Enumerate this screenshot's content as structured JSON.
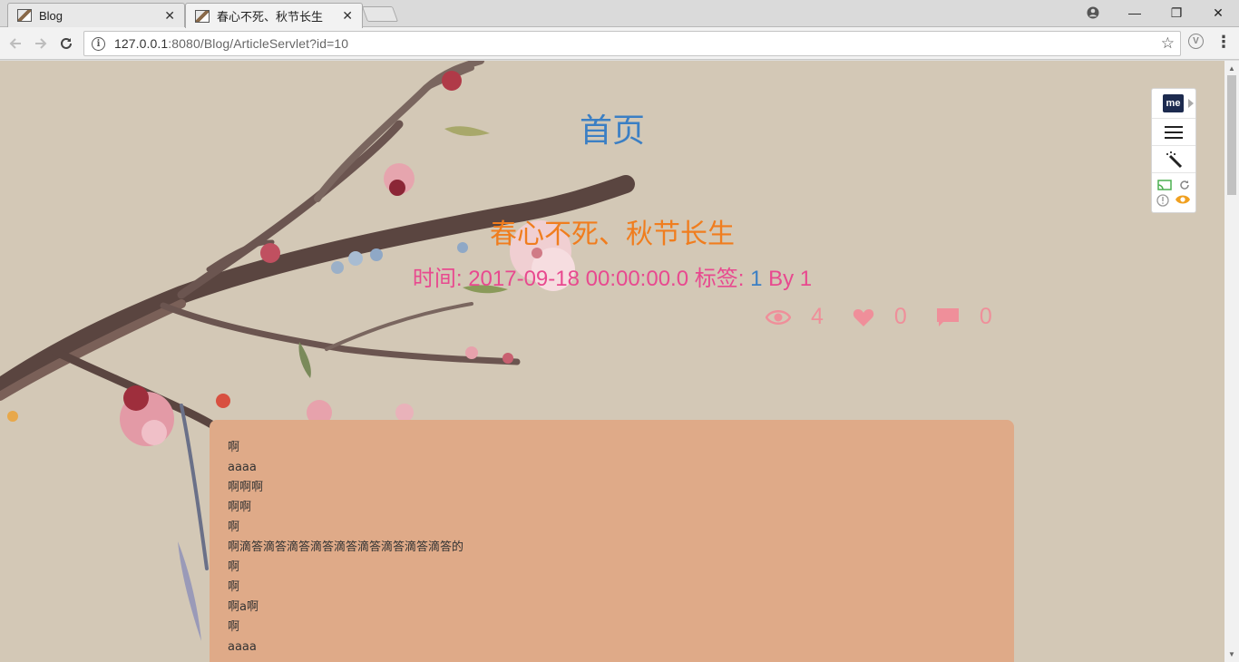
{
  "browser": {
    "tabs": [
      {
        "title": "Blog",
        "active": false
      },
      {
        "title": "春心不死、秋节长生",
        "active": true
      }
    ],
    "close_glyph": "✕",
    "address": {
      "host": "127.0.0.1",
      "rest": ":8080/Blog/ArticleServlet?id=10"
    },
    "window_controls": {
      "minimize": "—",
      "restore": "❐",
      "close": "✕"
    }
  },
  "page": {
    "home_link": "首页",
    "article_title": "春心不死、秋节长生",
    "meta": {
      "time_label": "时间: ",
      "time_value": "2017-09-18 00:00:00.0",
      "tag_label": " 标签: ",
      "tag_value": "1",
      "by_label": " By ",
      "author": "1"
    },
    "stats": {
      "views": "4",
      "likes": "0",
      "comments": "0"
    },
    "content_lines": [
      "啊",
      "aaaa",
      "啊啊啊",
      "啊啊",
      "啊",
      "啊滴答滴答滴答滴答滴答滴答滴答滴答滴答的",
      "啊",
      "啊",
      "啊a啊",
      "啊",
      "aaaa"
    ]
  },
  "extension_panel": {
    "logo_text": "me"
  },
  "colors": {
    "page_bg": "#d3c8b6",
    "link_blue": "#3b7fc4",
    "title_orange": "#f07d1e",
    "meta_pink": "#e8498f",
    "stat_pink": "#ef8f9a",
    "card_bg": "#dfaa88"
  },
  "icons": [
    "eye-icon",
    "heart-icon",
    "comment-icon",
    "info-icon",
    "star-icon",
    "reload-icon",
    "back-icon",
    "forward-icon",
    "menu-icon",
    "magic-wand-icon",
    "cast-icon",
    "refresh-icon",
    "alert-icon",
    "eye-toggle-icon"
  ]
}
